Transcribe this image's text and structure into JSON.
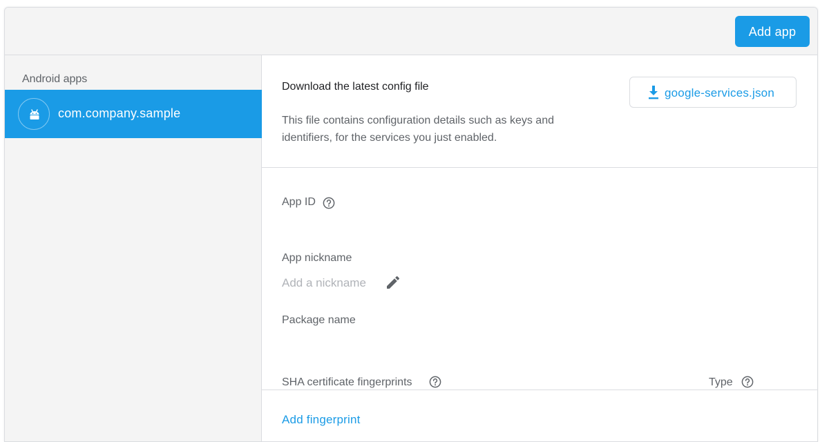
{
  "header": {
    "add_app_label": "Add app"
  },
  "sidebar": {
    "heading": "Android apps",
    "items": [
      {
        "label": "com.company.sample",
        "icon": "android-icon",
        "selected": true
      }
    ]
  },
  "config": {
    "title": "Download the latest config file",
    "description": "This file contains configuration details such as keys and identifiers, for the services you just enabled.",
    "download_label": "google-services.json",
    "download_icon": "download-icon"
  },
  "fields": {
    "app_id_label": "App ID",
    "app_nickname_label": "App nickname",
    "nickname_placeholder": "Add a nickname",
    "package_name_label": "Package name",
    "sha_label": "SHA certificate fingerprints",
    "type_label": "Type",
    "add_fingerprint_label": "Add fingerprint"
  },
  "colors": {
    "accent": "#1a9be6",
    "header_bg": "#f4f4f4",
    "border": "#dadce0",
    "text_primary": "#202124",
    "text_secondary": "#5f6368",
    "placeholder": "#b0b3b8"
  }
}
